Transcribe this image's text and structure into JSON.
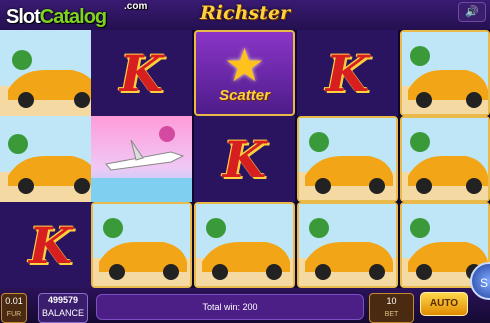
{
  "header": {
    "watermark_slot": "Slot",
    "watermark_catalog": "Catalog",
    "watermark_com": ".com",
    "game_title": "Richster",
    "sound_icon": "speaker-icon"
  },
  "reels": [
    [
      "car",
      "car",
      "K"
    ],
    [
      "K",
      "plane",
      "car"
    ],
    [
      "scatter",
      "K",
      "car"
    ],
    [
      "K",
      "car",
      "car"
    ],
    [
      "car",
      "car",
      "car"
    ]
  ],
  "symbols": {
    "K": "K",
    "scatter": "Scatter"
  },
  "footer": {
    "bet_value": "0.01",
    "bet_label": "FUR",
    "balance_value": "499579",
    "balance_label": "BALANCE",
    "total_win": "Total win: 200",
    "lines_value": "10",
    "lines_label": "BET",
    "auto_label": "AUTO",
    "spin_label": "S"
  }
}
